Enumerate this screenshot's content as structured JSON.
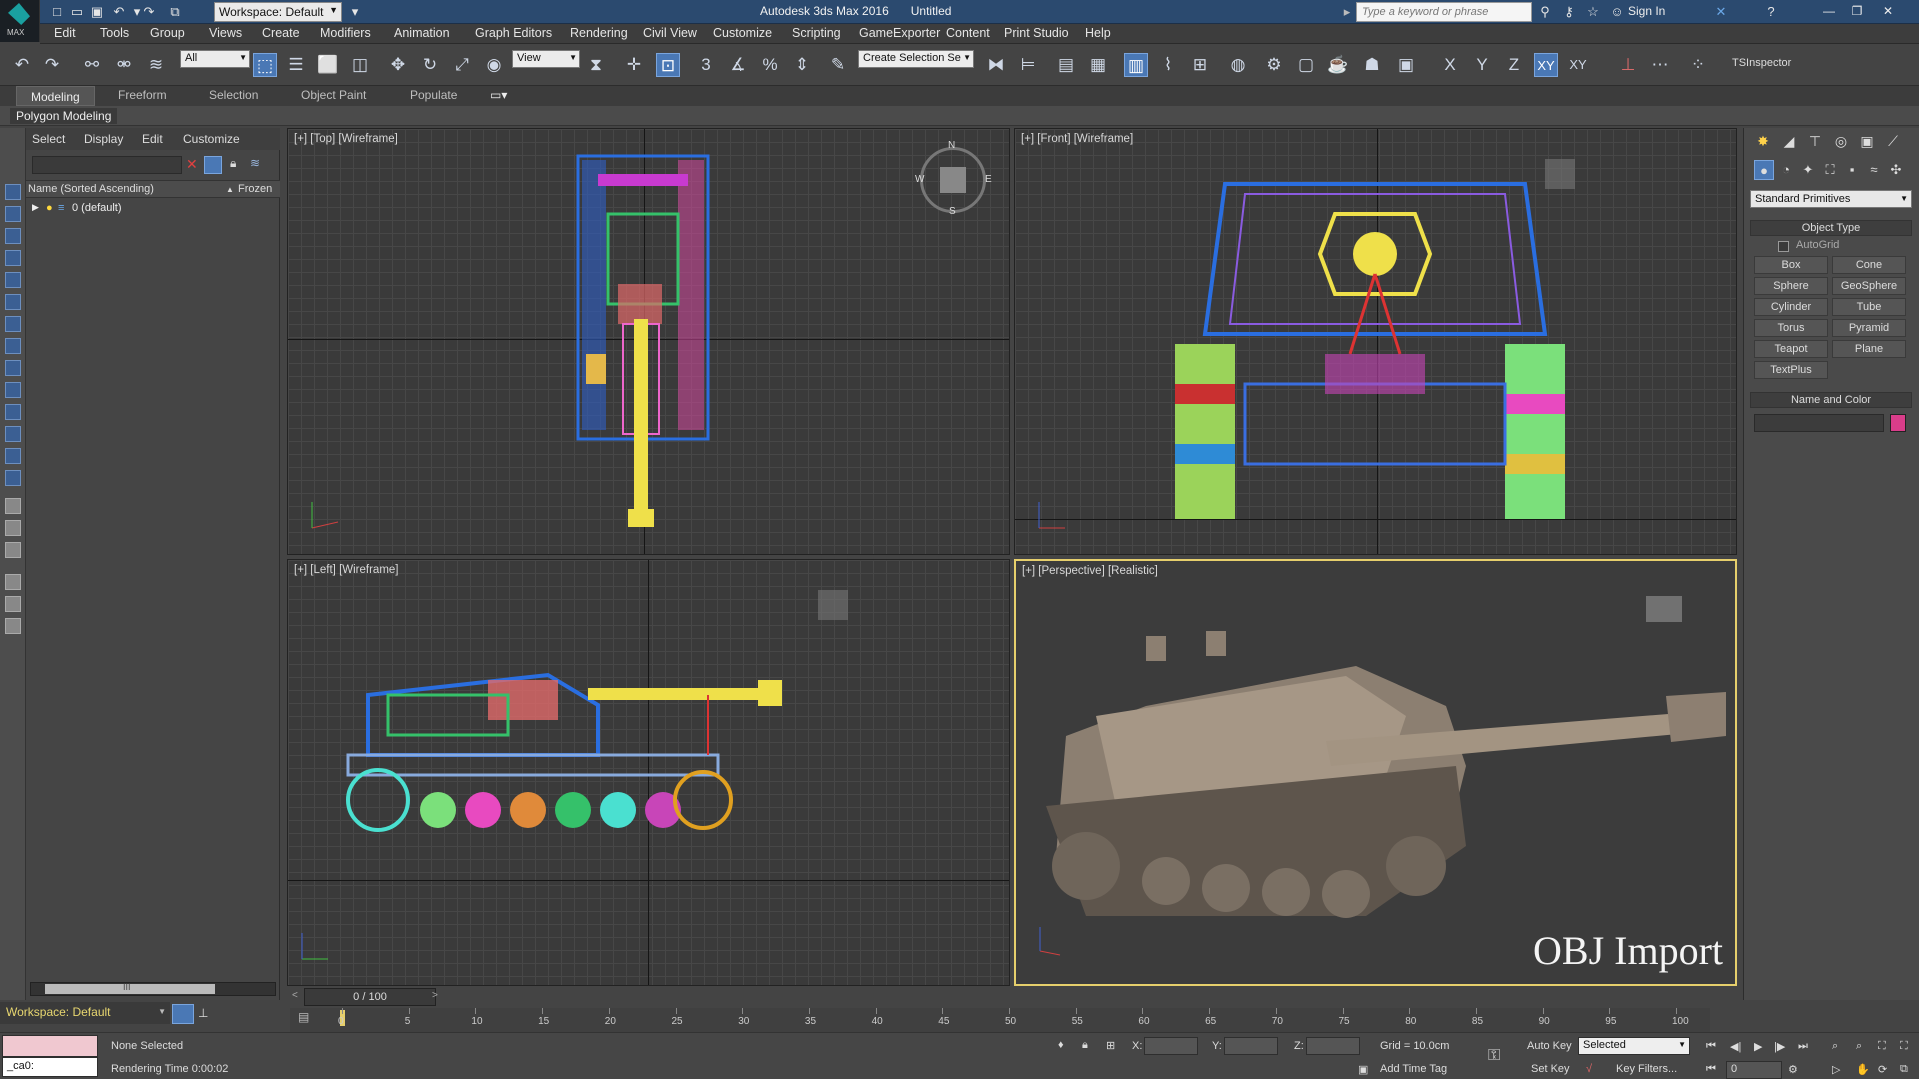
{
  "app": {
    "title": "Autodesk 3ds Max 2016",
    "document": "Untitled",
    "logo_text": "MAX",
    "search_placeholder": "Type a keyword or phrase",
    "sign_in": "Sign In",
    "workspace": "Workspace: Default"
  },
  "menu": [
    "Edit",
    "Tools",
    "Group",
    "Views",
    "Create",
    "Modifiers",
    "Animation",
    "Graph Editors",
    "Rendering",
    "Civil View",
    "Customize",
    "Scripting",
    "GameExporter",
    "Content",
    "Print Studio",
    "Help"
  ],
  "toolbar": {
    "filter": "All",
    "coord_system": "View",
    "selection_set": "Create Selection Se",
    "axes": [
      "X",
      "Y",
      "Z",
      "XY",
      "XY"
    ],
    "inspector": "TSInspector"
  },
  "ribbon": {
    "tabs": [
      "Modeling",
      "Freeform",
      "Selection",
      "Object Paint",
      "Populate"
    ],
    "active_tab": "Modeling",
    "panel": "Polygon Modeling"
  },
  "scene_explorer": {
    "menu": [
      "Select",
      "Display",
      "Edit",
      "Customize"
    ],
    "column_name": "Name (Sorted Ascending)",
    "column_frozen": "Frozen",
    "rows": [
      "0 (default)"
    ],
    "scroll_label": "III"
  },
  "viewports": {
    "top": "[+] [Top] [Wireframe]",
    "front": "[+] [Front] [Wireframe]",
    "left": "[+] [Left] [Wireframe]",
    "perspective": "[+] [Perspective] [Realistic]",
    "watermark": "OBJ Import",
    "compass": [
      "N",
      "S",
      "E",
      "W"
    ]
  },
  "command_panel": {
    "category": "Standard Primitives",
    "object_type": "Object Type",
    "autogrid": "AutoGrid",
    "primitives": [
      "Box",
      "Cone",
      "Sphere",
      "GeoSphere",
      "Cylinder",
      "Tube",
      "Torus",
      "Pyramid",
      "Teapot",
      "Plane",
      "TextPlus"
    ],
    "name_and_color": "Name and Color",
    "swatch_color": "#d93d8a"
  },
  "timeline": {
    "slider": "0 / 100",
    "ticks": [
      "0",
      "5",
      "10",
      "15",
      "20",
      "25",
      "30",
      "35",
      "40",
      "45",
      "50",
      "55",
      "60",
      "65",
      "70",
      "75",
      "80",
      "85",
      "90",
      "95",
      "100"
    ]
  },
  "status": {
    "maxscript": "_ca0:",
    "selection": "None Selected",
    "render_time": "Rendering Time  0:00:02",
    "x_label": "X:",
    "y_label": "Y:",
    "z_label": "Z:",
    "grid": "Grid = 10.0cm",
    "add_time_tag": "Add Time Tag",
    "auto_key": "Auto Key",
    "set_key": "Set Key",
    "key_mode": "Selected",
    "key_filters": "Key Filters...",
    "frame": "0"
  }
}
